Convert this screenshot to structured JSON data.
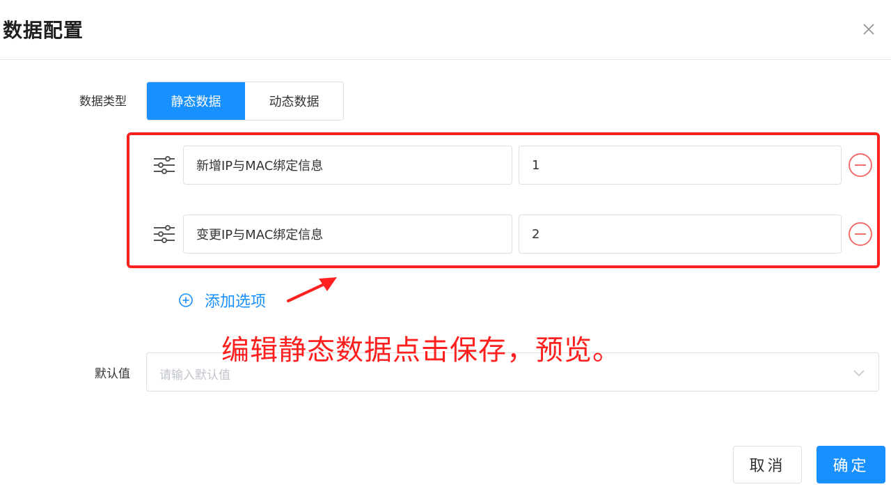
{
  "dialog": {
    "title": "数据配置",
    "close_icon": "close-icon"
  },
  "data_type": {
    "label": "数据类型",
    "options": [
      {
        "label": "静态数据",
        "active": true
      },
      {
        "label": "动态数据",
        "active": false
      }
    ]
  },
  "options": [
    {
      "label": "新增IP与MAC绑定信息",
      "value": "1"
    },
    {
      "label": "变更IP与MAC绑定信息",
      "value": "2"
    }
  ],
  "add_option": {
    "label": "添加选项",
    "icon": "plus-circle-icon"
  },
  "annotation": {
    "text": "编辑静态数据点击保存，预览。",
    "color": "#ff1f1f"
  },
  "default_value": {
    "label": "默认值",
    "placeholder": "请输入默认值"
  },
  "footer": {
    "cancel_label": "取消",
    "ok_label": "确定"
  },
  "colors": {
    "primary": "#1890ff",
    "highlight": "#ff2020",
    "danger": "#f56c6c"
  }
}
